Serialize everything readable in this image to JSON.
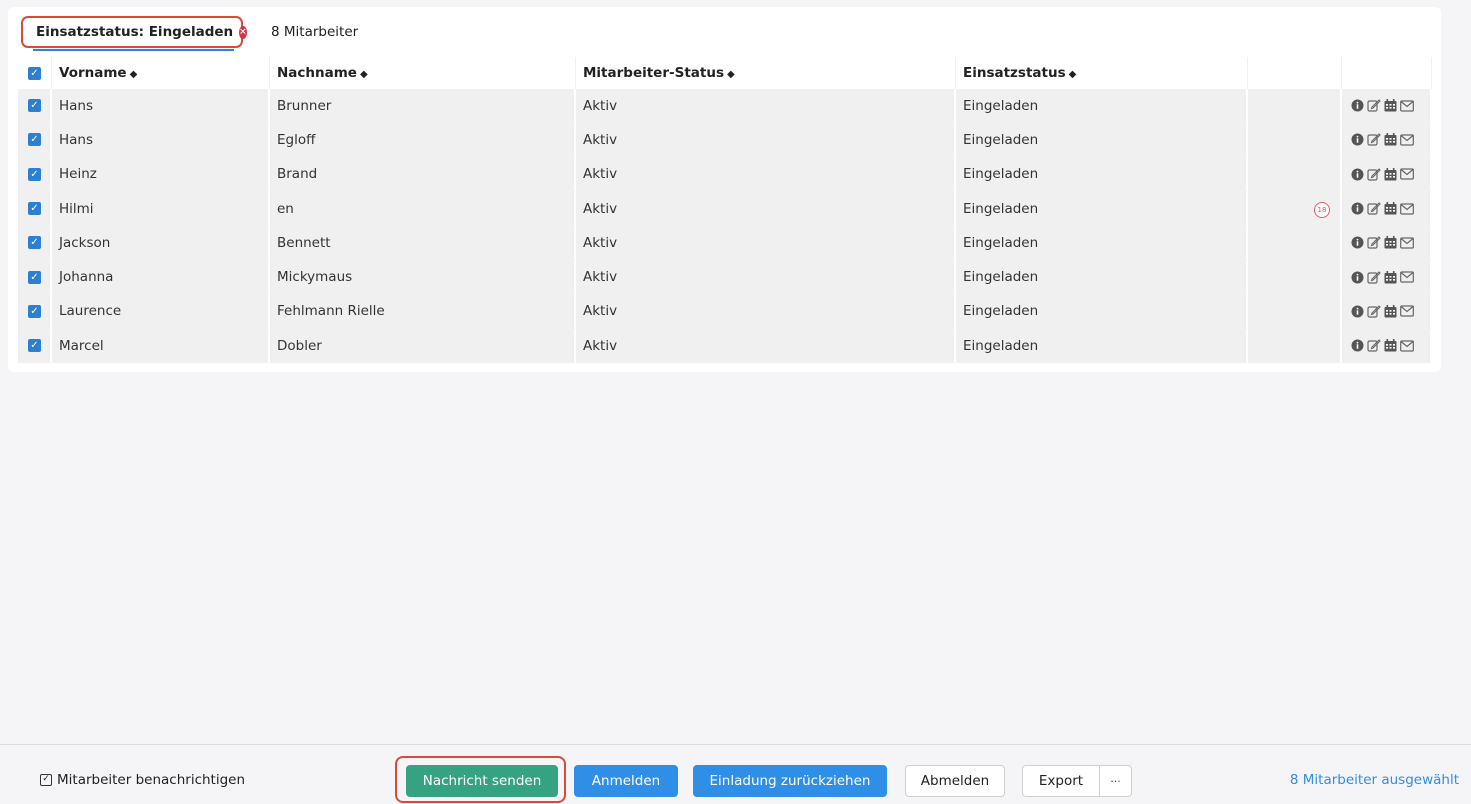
{
  "filter": {
    "label": "Einsatzstatus: Eingeladen",
    "count": "8 Mitarbeiter"
  },
  "table": {
    "headers": {
      "firstname": "Vorname",
      "lastname": "Nachname",
      "employee_status": "Mitarbeiter-Status",
      "assignment_status": "Einsatzstatus"
    },
    "rows": [
      {
        "firstname": "Hans",
        "lastname": "Brunner",
        "employee_status": "Aktiv",
        "assignment_status": "Eingeladen",
        "badge": ""
      },
      {
        "firstname": "Hans",
        "lastname": "Egloff",
        "employee_status": "Aktiv",
        "assignment_status": "Eingeladen",
        "badge": ""
      },
      {
        "firstname": "Heinz",
        "lastname": "Brand",
        "employee_status": "Aktiv",
        "assignment_status": "Eingeladen",
        "badge": ""
      },
      {
        "firstname": "Hilmi",
        "lastname": "en",
        "employee_status": "Aktiv",
        "assignment_status": "Eingeladen",
        "badge": "18"
      },
      {
        "firstname": "Jackson",
        "lastname": "Bennett",
        "employee_status": "Aktiv",
        "assignment_status": "Eingeladen",
        "badge": ""
      },
      {
        "firstname": "Johanna",
        "lastname": "Mickymaus",
        "employee_status": "Aktiv",
        "assignment_status": "Eingeladen",
        "badge": ""
      },
      {
        "firstname": "Laurence",
        "lastname": "Fehlmann Rielle",
        "employee_status": "Aktiv",
        "assignment_status": "Eingeladen",
        "badge": ""
      },
      {
        "firstname": "Marcel",
        "lastname": "Dobler",
        "employee_status": "Aktiv",
        "assignment_status": "Eingeladen",
        "badge": ""
      }
    ],
    "row_icons": [
      "info-icon",
      "edit-icon",
      "calendar-icon",
      "envelope-icon"
    ]
  },
  "footer": {
    "notify_label": "Mitarbeiter benachrichtigen",
    "send_message": "Nachricht senden",
    "register": "Anmelden",
    "withdraw_invitation": "Einladung zurückziehen",
    "unregister": "Abmelden",
    "export": "Export",
    "more": "···",
    "selected_count": "8 Mitarbeiter ausgewählt"
  },
  "colors": {
    "accent": "#2f8ee5",
    "send_button": "#35a382",
    "highlight": "#d94a3a",
    "badge": "#e35a5a"
  }
}
